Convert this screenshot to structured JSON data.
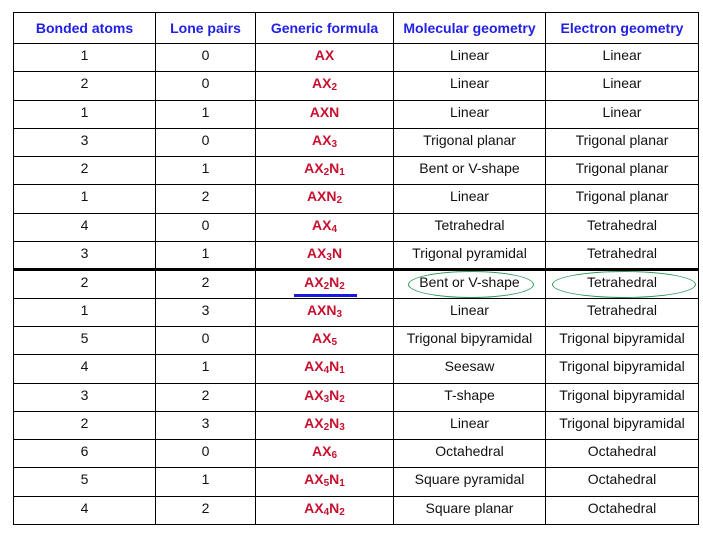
{
  "table": {
    "headers": [
      "Bonded atoms",
      "Lone pairs",
      "Generic formula",
      "Molecular geometry",
      "Electron geometry"
    ],
    "rows": [
      {
        "bonded": "1",
        "lone": "0",
        "formula": [
          [
            "AX",
            ""
          ]
        ],
        "molecular": "Linear",
        "electron": "Linear"
      },
      {
        "bonded": "2",
        "lone": "0",
        "formula": [
          [
            "AX",
            "2"
          ]
        ],
        "molecular": "Linear",
        "electron": "Linear"
      },
      {
        "bonded": "1",
        "lone": "1",
        "formula": [
          [
            "AXN",
            ""
          ]
        ],
        "molecular": "Linear",
        "electron": "Linear"
      },
      {
        "bonded": "3",
        "lone": "0",
        "formula": [
          [
            "AX",
            "3"
          ]
        ],
        "molecular": "Trigonal planar",
        "electron": "Trigonal planar"
      },
      {
        "bonded": "2",
        "lone": "1",
        "formula": [
          [
            "AX",
            "2"
          ],
          [
            "N",
            "1"
          ]
        ],
        "molecular": "Bent or V-shape",
        "electron": "Trigonal planar"
      },
      {
        "bonded": "1",
        "lone": "2",
        "formula": [
          [
            "AXN",
            "2"
          ]
        ],
        "molecular": "Linear",
        "electron": "Trigonal planar"
      },
      {
        "bonded": "4",
        "lone": "0",
        "formula": [
          [
            "AX",
            "4"
          ]
        ],
        "molecular": "Tetrahedral",
        "electron": "Tetrahedral"
      },
      {
        "bonded": "3",
        "lone": "1",
        "formula": [
          [
            "AX",
            "3"
          ],
          [
            "N",
            ""
          ]
        ],
        "molecular": "Trigonal pyramidal",
        "electron": "Tetrahedral"
      },
      {
        "bonded": "2",
        "lone": "2",
        "formula": [
          [
            "AX",
            "2"
          ],
          [
            "N",
            "2"
          ]
        ],
        "molecular": "Bent or V-shape",
        "electron": "Tetrahedral",
        "highlighted": true
      },
      {
        "bonded": "1",
        "lone": "3",
        "formula": [
          [
            "AXN",
            "3"
          ]
        ],
        "molecular": "Linear",
        "electron": "Tetrahedral"
      },
      {
        "bonded": "5",
        "lone": "0",
        "formula": [
          [
            "AX",
            "5"
          ]
        ],
        "molecular": "Trigonal bipyramidal",
        "electron": "Trigonal bipyramidal"
      },
      {
        "bonded": "4",
        "lone": "1",
        "formula": [
          [
            "AX",
            "4"
          ],
          [
            "N",
            "1"
          ]
        ],
        "molecular": "Seesaw",
        "electron": "Trigonal bipyramidal"
      },
      {
        "bonded": "3",
        "lone": "2",
        "formula": [
          [
            "AX",
            "3"
          ],
          [
            "N",
            "2"
          ]
        ],
        "molecular": "T-shape",
        "electron": "Trigonal bipyramidal"
      },
      {
        "bonded": "2",
        "lone": "3",
        "formula": [
          [
            "AX",
            "2"
          ],
          [
            "N",
            "3"
          ]
        ],
        "molecular": "Linear",
        "electron": "Trigonal bipyramidal"
      },
      {
        "bonded": "6",
        "lone": "0",
        "formula": [
          [
            "AX",
            "6"
          ]
        ],
        "molecular": "Octahedral",
        "electron": "Octahedral"
      },
      {
        "bonded": "5",
        "lone": "1",
        "formula": [
          [
            "AX",
            "5"
          ],
          [
            "N",
            "1"
          ]
        ],
        "molecular": "Square pyramidal",
        "electron": "Octahedral"
      },
      {
        "bonded": "4",
        "lone": "2",
        "formula": [
          [
            "AX",
            "4"
          ],
          [
            "N",
            "2"
          ]
        ],
        "molecular": "Square planar",
        "electron": "Octahedral"
      }
    ]
  },
  "colors": {
    "header_text": "#2020e6",
    "formula_text": "#c8102e",
    "ellipse_annotation": "#2e9a57",
    "underline_annotation": "#1a1ae0"
  }
}
